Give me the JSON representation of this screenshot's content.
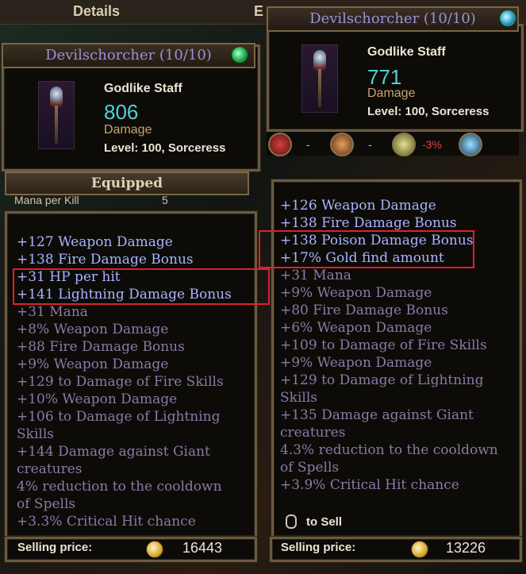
{
  "header": {
    "tab_details": "Details",
    "tab_cut": "E"
  },
  "left": {
    "title": "Devilschorcher (10/10)",
    "item_type": "Godlike Staff",
    "damage": "806",
    "damage_label": "Damage",
    "level": "Level: 100, Sorceress",
    "equipped_label": "Equipped",
    "behind_row": {
      "label": "Mana per Kill",
      "value": "5"
    },
    "magic_stats": [
      "+127 Weapon Damage",
      "+138 Fire Damage Bonus",
      "+31 HP per hit",
      "+141 Lightning Damage Bonus"
    ],
    "imbue_stats": [
      "+31 Mana",
      "+8% Weapon Damage",
      "+88 Fire Damage Bonus",
      "+9% Weapon Damage",
      "+129 to Damage of Fire Skills",
      "+10% Weapon Damage",
      "+106 to Damage of Lightning",
      "Skills",
      "+144 Damage against Giant",
      "creatures",
      "4% reduction to the cooldown",
      "of Spells",
      "+3.3% Critical Hit chance"
    ],
    "selling_label": "Selling price:",
    "selling_price": "16443"
  },
  "right": {
    "title": "Devilschorcher (10/10)",
    "item_type": "Godlike Staff",
    "damage": "771",
    "damage_label": "Damage",
    "level": "Level: 100, Sorceress",
    "compare": {
      "v1": "-",
      "v2": "-",
      "v3": "-3%"
    },
    "magic_stats": [
      "+126 Weapon Damage",
      "+138 Fire Damage Bonus",
      "+138 Poison Damage Bonus",
      "+17% Gold find amount"
    ],
    "imbue_stats": [
      "+31 Mana",
      "+9% Weapon Damage",
      "+80 Fire Damage Bonus",
      "+6% Weapon Damage",
      "+109 to Damage of Fire Skills",
      "+9% Weapon Damage",
      "+129 to Damage of Lightning",
      "Skills",
      "+135 Damage against Giant",
      "creatures",
      "4.3% reduction to the cooldown",
      "of Spells",
      "+3.9% Critical Hit chance"
    ],
    "to_sell": "to Sell",
    "selling_label": "Selling price:",
    "selling_price": "13226"
  },
  "colors": {
    "magic": "#a8b4ff",
    "imbue": "#8a7aa6",
    "damage": "#4fd1d0",
    "highlight": "#e0202a"
  },
  "icons": [
    "swirl-icon",
    "staff-icon",
    "heart-icon",
    "shield-icon",
    "dagger-icon",
    "frost-icon",
    "mouse-icon",
    "coin-icon"
  ]
}
